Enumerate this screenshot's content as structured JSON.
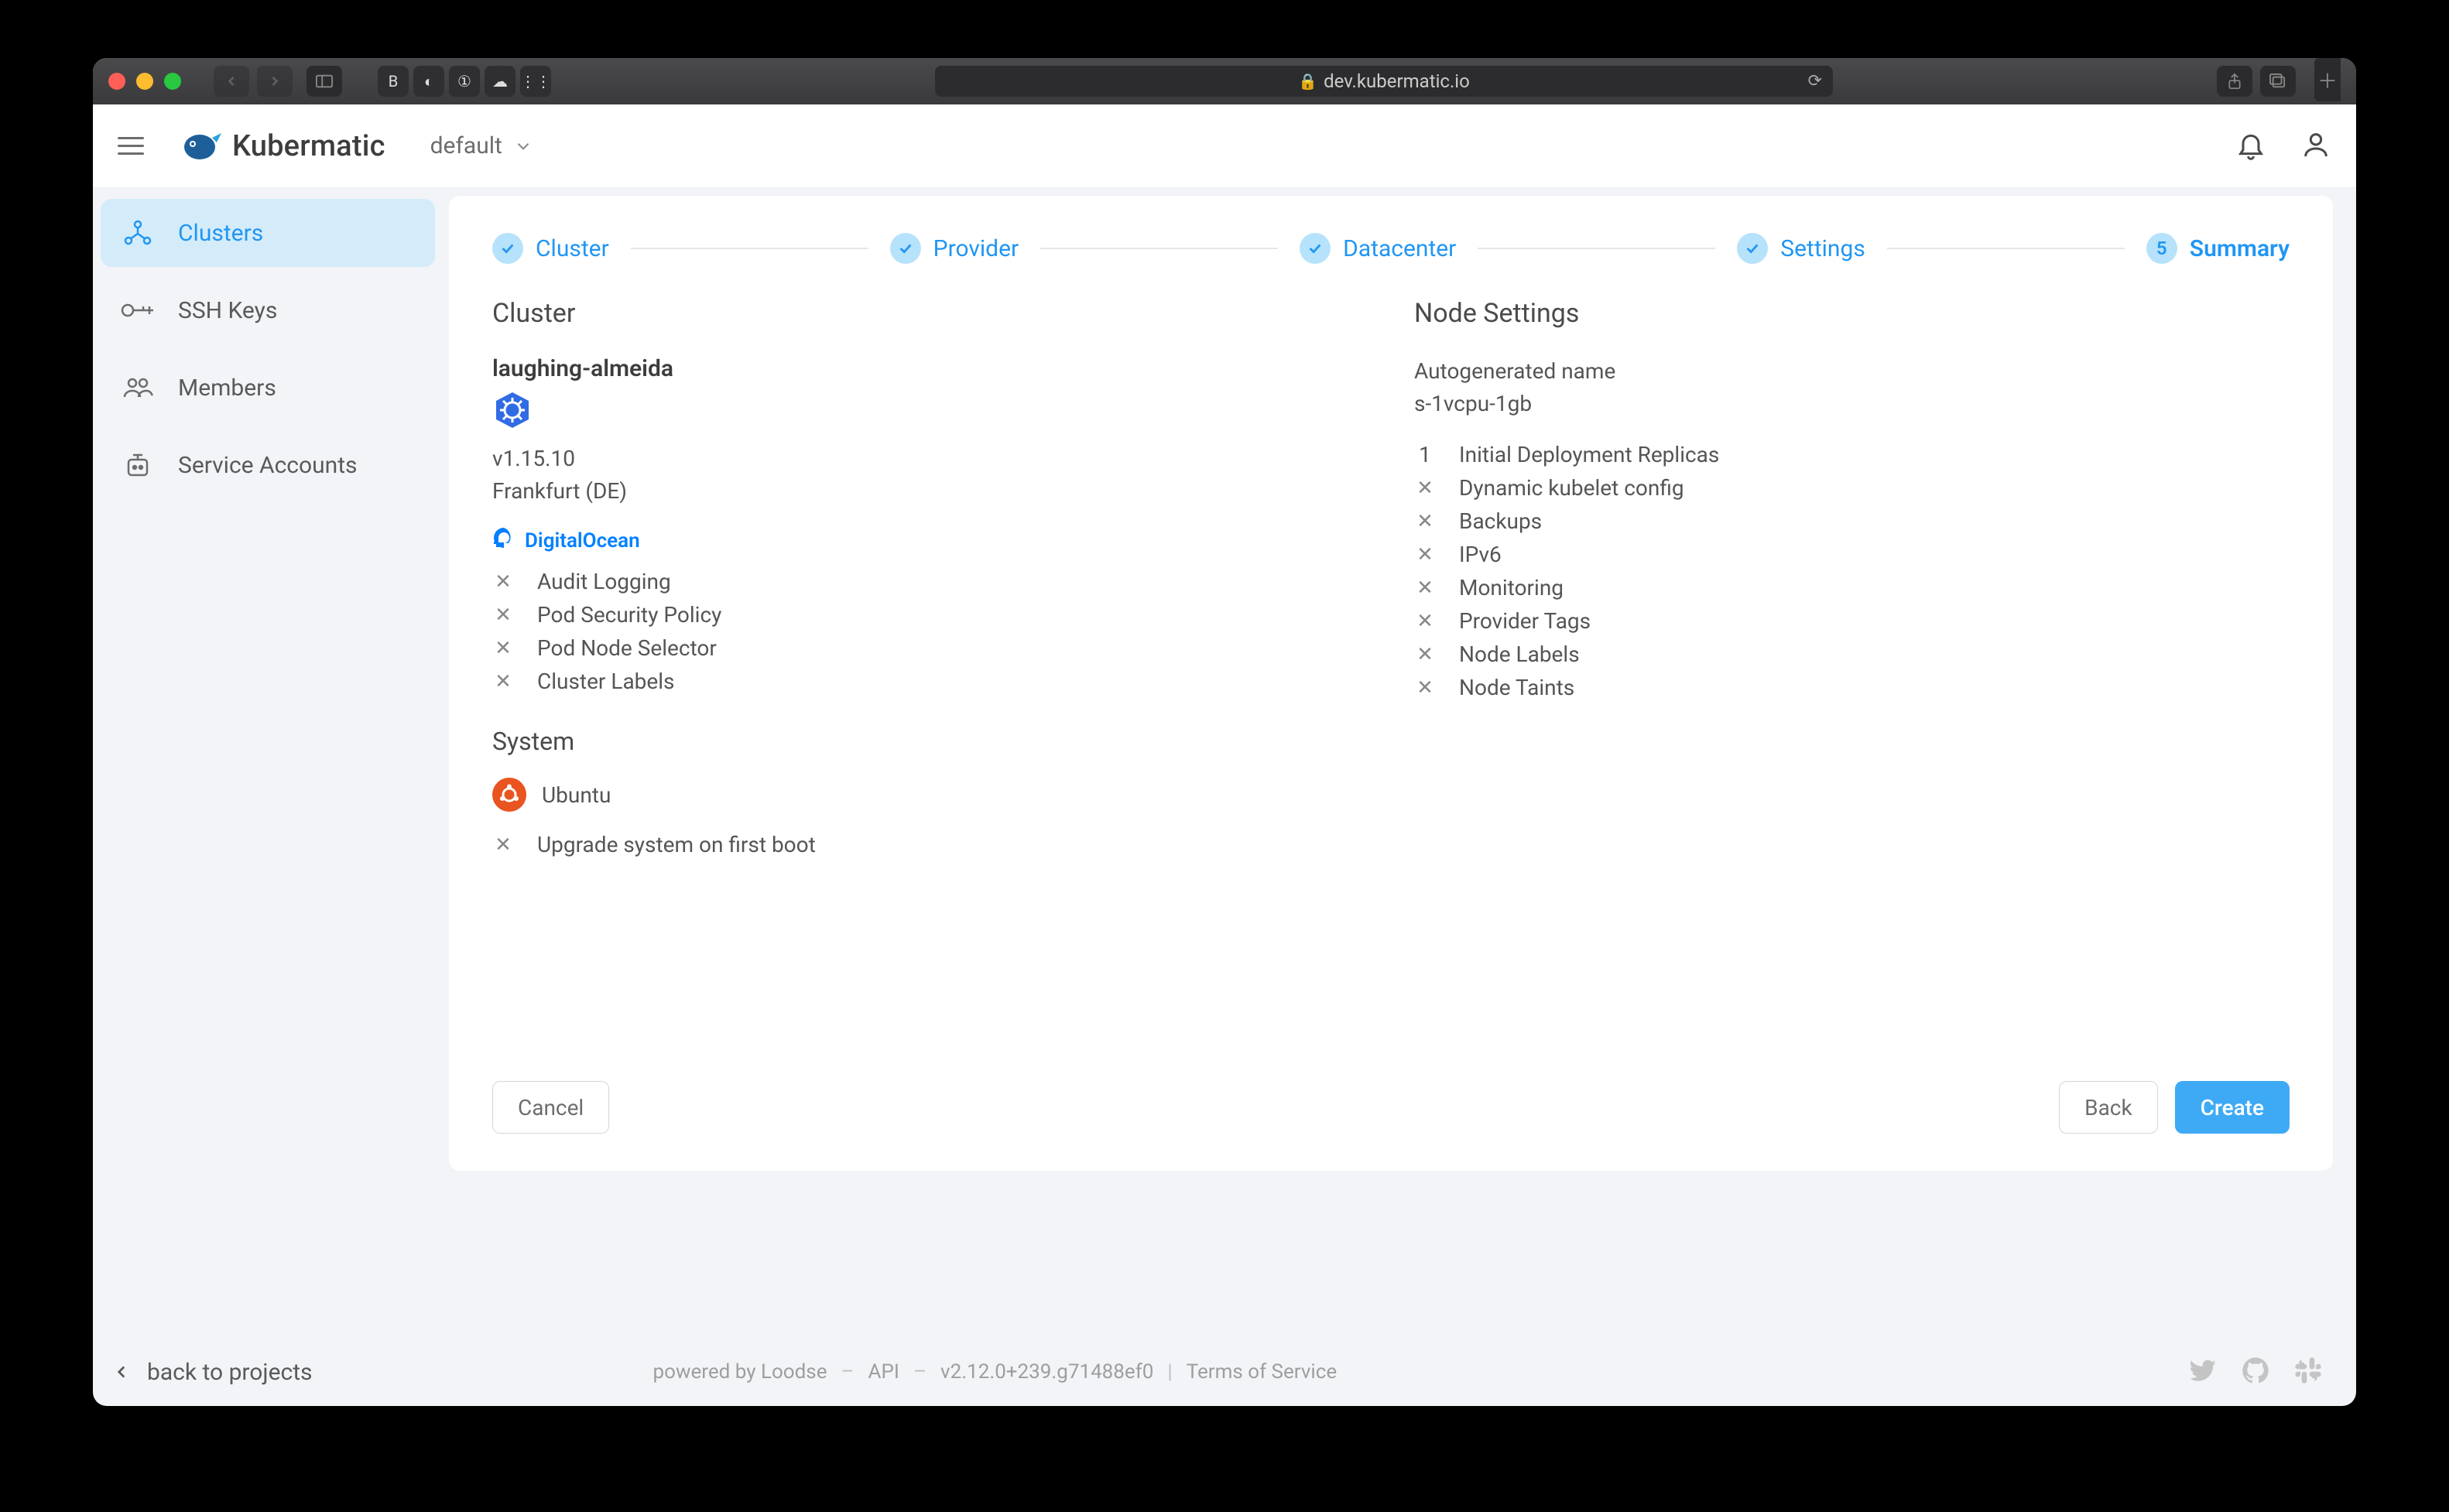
{
  "browser": {
    "url": "dev.kubermatic.io"
  },
  "header": {
    "brand": "Kubermatic",
    "project": "default"
  },
  "sidebar": {
    "items": [
      {
        "label": "Clusters",
        "icon": "clusters-icon",
        "active": true
      },
      {
        "label": "SSH Keys",
        "icon": "key-icon",
        "active": false
      },
      {
        "label": "Members",
        "icon": "members-icon",
        "active": false
      },
      {
        "label": "Service Accounts",
        "icon": "robot-icon",
        "active": false
      }
    ]
  },
  "wizard": {
    "steps": [
      {
        "label": "Cluster",
        "state": "done"
      },
      {
        "label": "Provider",
        "state": "done"
      },
      {
        "label": "Datacenter",
        "state": "done"
      },
      {
        "label": "Settings",
        "state": "done"
      },
      {
        "label": "Summary",
        "state": "current",
        "index": "5"
      }
    ],
    "cluster": {
      "title": "Cluster",
      "name": "laughing-almeida",
      "version": "v1.15.10",
      "location": "Frankfurt (DE)",
      "provider": "DigitalOcean",
      "flags": [
        {
          "on": false,
          "label": "Audit Logging"
        },
        {
          "on": false,
          "label": "Pod Security Policy"
        },
        {
          "on": false,
          "label": "Pod Node Selector"
        },
        {
          "on": false,
          "label": "Cluster Labels"
        }
      ]
    },
    "system": {
      "title": "System",
      "os": "Ubuntu",
      "flags": [
        {
          "on": false,
          "label": "Upgrade system on first boot"
        }
      ]
    },
    "node": {
      "title": "Node Settings",
      "name": "Autogenerated name",
      "size": "s-1vcpu-1gb",
      "replicas": {
        "count": "1",
        "label": "Initial Deployment Replicas"
      },
      "flags": [
        {
          "on": false,
          "label": "Dynamic kubelet config"
        },
        {
          "on": false,
          "label": "Backups"
        },
        {
          "on": false,
          "label": "IPv6"
        },
        {
          "on": false,
          "label": "Monitoring"
        },
        {
          "on": false,
          "label": "Provider Tags"
        },
        {
          "on": false,
          "label": "Node Labels"
        },
        {
          "on": false,
          "label": "Node Taints"
        }
      ]
    },
    "buttons": {
      "cancel": "Cancel",
      "back": "Back",
      "create": "Create"
    }
  },
  "footer": {
    "back_projects": "back to projects",
    "powered": "powered by Loodse",
    "api": "API",
    "version": "v2.12.0+239.g71488ef0",
    "tos": "Terms of Service"
  }
}
